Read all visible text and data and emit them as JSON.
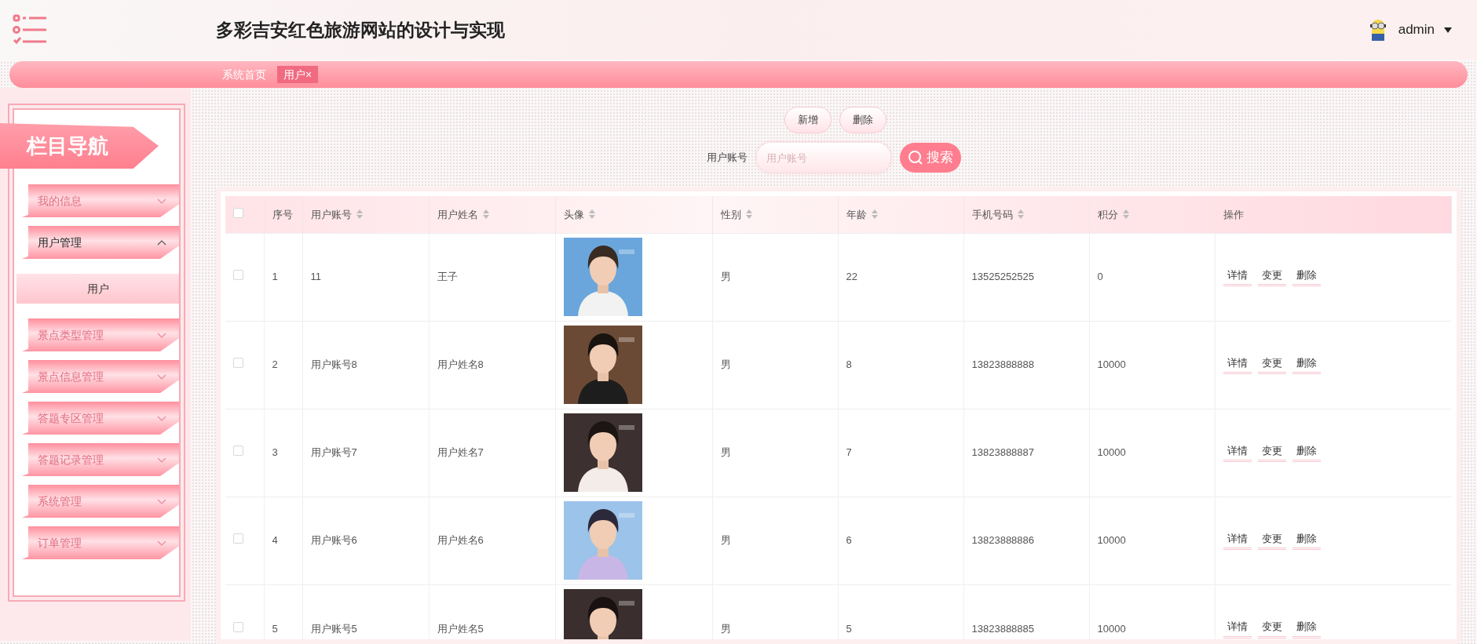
{
  "header": {
    "title": "多彩吉安红色旅游网站的设计与实现",
    "user": "admin"
  },
  "breadcrumbs": [
    {
      "label": "系统首页",
      "selected": false
    },
    {
      "label": "用户",
      "selected": true,
      "close": "×"
    }
  ],
  "sidebar": {
    "title": "栏目导航",
    "items": [
      {
        "label": "我的信息",
        "expanded": false
      },
      {
        "label": "用户管理",
        "expanded": true,
        "children": [
          {
            "label": "用户"
          }
        ]
      },
      {
        "label": "景点类型管理",
        "expanded": false
      },
      {
        "label": "景点信息管理",
        "expanded": false
      },
      {
        "label": "答题专区管理",
        "expanded": false
      },
      {
        "label": "答题记录管理",
        "expanded": false
      },
      {
        "label": "系统管理",
        "expanded": false
      },
      {
        "label": "订单管理",
        "expanded": false
      }
    ]
  },
  "toolbar": {
    "buttons": [
      "新增",
      "删除"
    ]
  },
  "search": {
    "label": "用户账号",
    "placeholder": "用户账号",
    "button": "搜索"
  },
  "table": {
    "select_all": {
      "checked": false
    },
    "columns": [
      {
        "label": "序号",
        "sortable": false
      },
      {
        "label": "用户账号",
        "sortable": true
      },
      {
        "label": "用户姓名",
        "sortable": true
      },
      {
        "label": "头像",
        "sortable": true
      },
      {
        "label": "性别",
        "sortable": true
      },
      {
        "label": "年龄",
        "sortable": true
      },
      {
        "label": "手机号码",
        "sortable": true
      },
      {
        "label": "积分",
        "sortable": true
      },
      {
        "label": "操作",
        "sortable": false
      }
    ],
    "rows": [
      {
        "checked": false,
        "cells": [
          "1",
          "11",
          "王子"
        ],
        "avatar": {
          "kind": "picture"
        },
        "cells2": [
          "男",
          "22",
          "13525252525",
          "0"
        ],
        "actions": [
          "详情",
          "变更",
          "删除"
        ]
      },
      {
        "checked": false,
        "cells": [
          "2",
          "用户账号8",
          "用户姓名8"
        ],
        "avatar": {
          "kind": "picture"
        },
        "cells2": [
          "男",
          "8",
          "13823888888",
          "10000"
        ],
        "actions": [
          "详情",
          "变更",
          "删除"
        ]
      },
      {
        "checked": false,
        "cells": [
          "3",
          "用户账号7",
          "用户姓名7"
        ],
        "avatar": {
          "kind": "picture"
        },
        "cells2": [
          "男",
          "7",
          "13823888887",
          "10000"
        ],
        "actions": [
          "详情",
          "变更",
          "删除"
        ]
      },
      {
        "checked": false,
        "cells": [
          "4",
          "用户账号6",
          "用户姓名6"
        ],
        "avatar": {
          "kind": "picture"
        },
        "cells2": [
          "男",
          "6",
          "13823888886",
          "10000"
        ],
        "actions": [
          "详情",
          "变更",
          "删除"
        ]
      },
      {
        "checked": false,
        "cells": [
          "5",
          "用户账号5",
          "用户姓名5"
        ],
        "avatar": {
          "kind": "picture"
        },
        "cells2": [
          "男",
          "5",
          "13823888885",
          "10000"
        ],
        "actions": [
          "详情",
          "变更",
          "删除"
        ]
      }
    ]
  }
}
